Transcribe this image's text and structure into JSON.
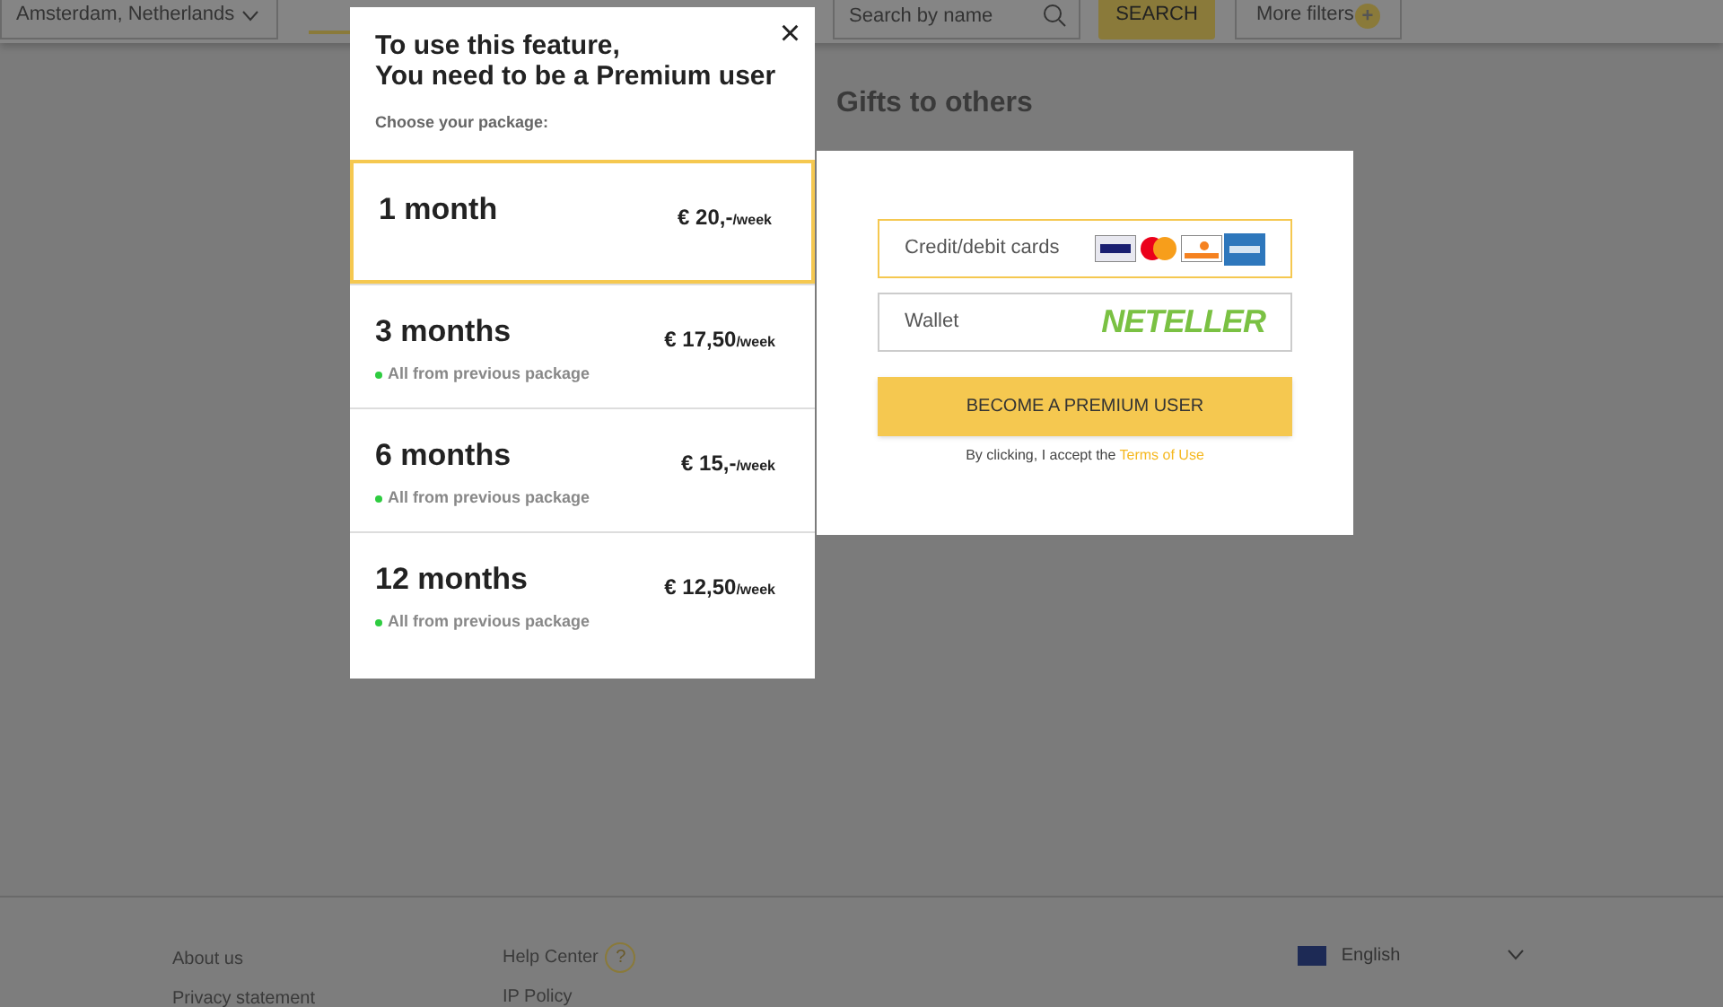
{
  "header": {
    "location": "Amsterdam, Netherlands",
    "search": {
      "placeholder": "Search by name"
    },
    "search_button": "SEARCH",
    "filters_button": "More filters",
    "filters_badge": "+"
  },
  "section_title": "Gifts to others",
  "modal": {
    "title": [
      "To use this feature,",
      "You need to be a Premium user"
    ],
    "close": "×",
    "subtitle": "Choose your package:",
    "packages": [
      {
        "name": "1 month",
        "price": "€ 20,-",
        "unit": "/week",
        "selected": true
      },
      {
        "name": "3 months",
        "feature": "All from previous package",
        "price": "€ 17,50",
        "unit": "/week",
        "selected": false
      },
      {
        "name": "6 months",
        "feature": "All from previous package",
        "price": "€ 15,-",
        "unit": "/week",
        "selected": false
      },
      {
        "name": "12 months",
        "feature": "All from previous package",
        "price": "€ 12,50",
        "unit": "/week",
        "selected": false
      }
    ]
  },
  "payment": {
    "methods": [
      {
        "label": "Credit/debit cards",
        "kind": "cards",
        "selected": true
      },
      {
        "label": "Wallet",
        "kind": "wallet",
        "logo": "NETELLER",
        "selected": false
      }
    ],
    "button": "BECOME A PREMIUM USER",
    "terms_prefix": "By clicking, I accept the",
    "terms_link": "Terms of Use"
  },
  "footer": {
    "columns": [
      [
        "About us",
        "Privacy statement"
      ],
      [
        "Help Center",
        "IP Policy"
      ]
    ],
    "help_icon": "?",
    "language": "English"
  }
}
